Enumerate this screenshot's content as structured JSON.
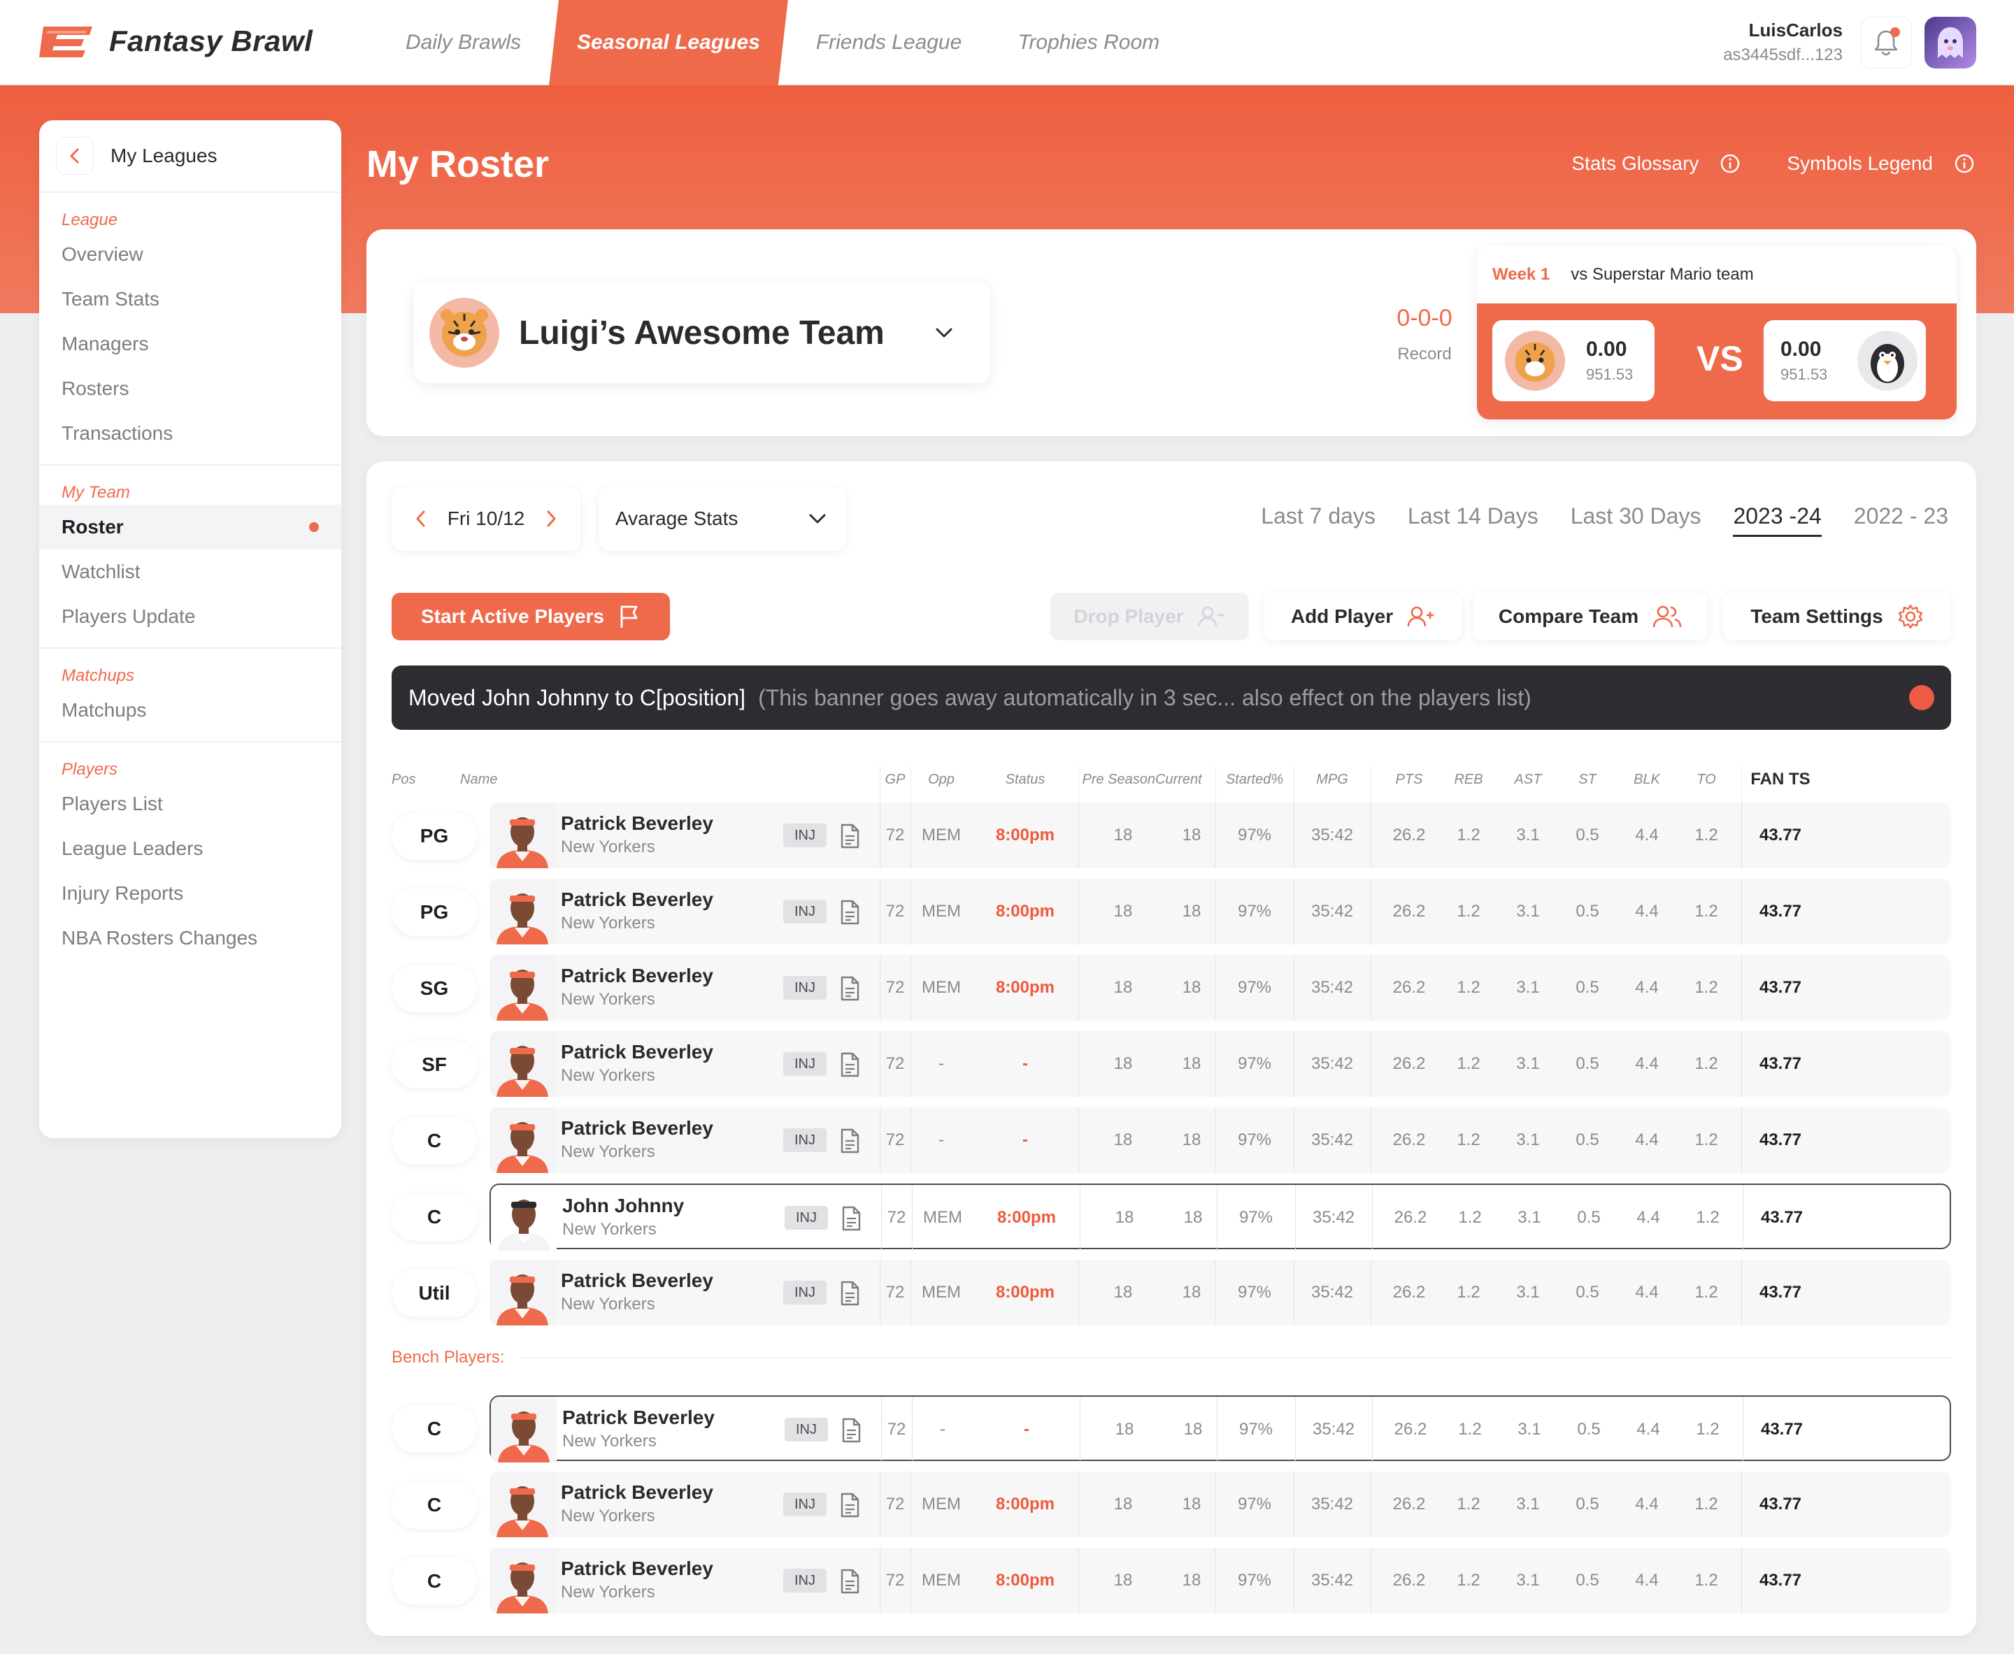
{
  "app": {
    "brand": "Fantasy Brawl",
    "nav": [
      {
        "label": "Daily Brawls",
        "active": false
      },
      {
        "label": "Seasonal Leagues",
        "active": true
      },
      {
        "label": "Friends League",
        "active": false
      },
      {
        "label": "Trophies Room",
        "active": false
      }
    ],
    "user": {
      "name": "LuisCarlos",
      "id": "as3445sdf...123"
    },
    "accent": "#ef6a4b"
  },
  "sidebar": {
    "title": "My Leagues",
    "sections": [
      {
        "label": "League",
        "items": [
          "Overview",
          "Team Stats",
          "Managers",
          "Rosters",
          "Transactions"
        ]
      },
      {
        "label": "My Team",
        "items": [
          "Roster",
          "Watchlist",
          "Players Update"
        ]
      },
      {
        "label": "Matchups",
        "items": [
          "Matchups"
        ]
      },
      {
        "label": "Players",
        "items": [
          "Players List",
          "League Leaders",
          "Injury Reports",
          "NBA Rosters Changes"
        ]
      }
    ],
    "active_item": "Roster"
  },
  "page": {
    "title": "My Roster",
    "links": [
      "Stats Glossary",
      "Symbols Legend"
    ]
  },
  "team": {
    "name": "Luigi’s Awesome Team",
    "record_value": "0-0-0",
    "record_label": "Record"
  },
  "matchup": {
    "week": "Week 1",
    "opponent": "vs Superstar Mario team",
    "home_score": "0.00",
    "home_proj": "951.53",
    "vs": "VS",
    "away_score": "0.00",
    "away_proj": "951.53"
  },
  "controls": {
    "date": "Fri 10/12",
    "stat_select": "Avarage Stats",
    "periods": [
      {
        "label": "Last 7 days",
        "active": false
      },
      {
        "label": "Last 14 Days",
        "active": false
      },
      {
        "label": "Last 30 Days",
        "active": false
      },
      {
        "label": "2023 -24",
        "active": true
      },
      {
        "label": "2022 - 23",
        "active": false
      }
    ],
    "buttons": {
      "start": "Start Active Players",
      "drop": "Drop Player",
      "add": "Add Player",
      "compare": "Compare Team",
      "settings": "Team Settings"
    }
  },
  "banner": {
    "main": "Moved John Johnny to C[position]",
    "sub": "(This banner goes away automatically in 3 sec... also effect on the players list)"
  },
  "table": {
    "headers": [
      "Pos",
      "Name",
      "GP",
      "Opp",
      "Status",
      "Pre Season",
      "Current",
      "Started%",
      "MPG",
      "PTS",
      "REB",
      "AST",
      "ST",
      "BLK",
      "TO",
      "FAN TS"
    ],
    "bench_label": "Bench Players:",
    "starters": [
      {
        "pos": "PG",
        "name": "Patrick Beverley",
        "team": "New Yorkers",
        "inj": "INJ",
        "gp": "72",
        "opp": "MEM",
        "status": "8:00pm",
        "pre": "18",
        "cur": "18",
        "started": "97%",
        "mpg": "35:42",
        "pts": "26.2",
        "reb": "1.2",
        "ast": "3.1",
        "st": "0.5",
        "blk": "4.4",
        "to": "1.2",
        "fan": "43.77",
        "selected": false,
        "photo": "orange"
      },
      {
        "pos": "PG",
        "name": "Patrick Beverley",
        "team": "New Yorkers",
        "inj": "INJ",
        "gp": "72",
        "opp": "MEM",
        "status": "8:00pm",
        "pre": "18",
        "cur": "18",
        "started": "97%",
        "mpg": "35:42",
        "pts": "26.2",
        "reb": "1.2",
        "ast": "3.1",
        "st": "0.5",
        "blk": "4.4",
        "to": "1.2",
        "fan": "43.77",
        "selected": false,
        "photo": "orange"
      },
      {
        "pos": "SG",
        "name": "Patrick Beverley",
        "team": "New Yorkers",
        "inj": "INJ",
        "gp": "72",
        "opp": "MEM",
        "status": "8:00pm",
        "pre": "18",
        "cur": "18",
        "started": "97%",
        "mpg": "35:42",
        "pts": "26.2",
        "reb": "1.2",
        "ast": "3.1",
        "st": "0.5",
        "blk": "4.4",
        "to": "1.2",
        "fan": "43.77",
        "selected": false,
        "photo": "orange"
      },
      {
        "pos": "SF",
        "name": "Patrick Beverley",
        "team": "New Yorkers",
        "inj": "INJ",
        "gp": "72",
        "opp": "-",
        "status": "-",
        "pre": "18",
        "cur": "18",
        "started": "97%",
        "mpg": "35:42",
        "pts": "26.2",
        "reb": "1.2",
        "ast": "3.1",
        "st": "0.5",
        "blk": "4.4",
        "to": "1.2",
        "fan": "43.77",
        "selected": false,
        "photo": "orange"
      },
      {
        "pos": "C",
        "name": "Patrick Beverley",
        "team": "New Yorkers",
        "inj": "INJ",
        "gp": "72",
        "opp": "-",
        "status": "-",
        "pre": "18",
        "cur": "18",
        "started": "97%",
        "mpg": "35:42",
        "pts": "26.2",
        "reb": "1.2",
        "ast": "3.1",
        "st": "0.5",
        "blk": "4.4",
        "to": "1.2",
        "fan": "43.77",
        "selected": false,
        "photo": "orange"
      },
      {
        "pos": "C",
        "name": "John Johnny",
        "team": "New Yorkers",
        "inj": "INJ",
        "gp": "72",
        "opp": "MEM",
        "status": "8:00pm",
        "pre": "18",
        "cur": "18",
        "started": "97%",
        "mpg": "35:42",
        "pts": "26.2",
        "reb": "1.2",
        "ast": "3.1",
        "st": "0.5",
        "blk": "4.4",
        "to": "1.2",
        "fan": "43.77",
        "selected": true,
        "photo": "white"
      },
      {
        "pos": "Util",
        "name": "Patrick Beverley",
        "team": "New Yorkers",
        "inj": "INJ",
        "gp": "72",
        "opp": "MEM",
        "status": "8:00pm",
        "pre": "18",
        "cur": "18",
        "started": "97%",
        "mpg": "35:42",
        "pts": "26.2",
        "reb": "1.2",
        "ast": "3.1",
        "st": "0.5",
        "blk": "4.4",
        "to": "1.2",
        "fan": "43.77",
        "selected": false,
        "photo": "orange"
      }
    ],
    "bench": [
      {
        "pos": "C",
        "name": "Patrick Beverley",
        "team": "New Yorkers",
        "inj": "INJ",
        "gp": "72",
        "opp": "-",
        "status": "-",
        "pre": "18",
        "cur": "18",
        "started": "97%",
        "mpg": "35:42",
        "pts": "26.2",
        "reb": "1.2",
        "ast": "3.1",
        "st": "0.5",
        "blk": "4.4",
        "to": "1.2",
        "fan": "43.77",
        "selected": true,
        "photo": "orange"
      },
      {
        "pos": "C",
        "name": "Patrick Beverley",
        "team": "New Yorkers",
        "inj": "INJ",
        "gp": "72",
        "opp": "MEM",
        "status": "8:00pm",
        "pre": "18",
        "cur": "18",
        "started": "97%",
        "mpg": "35:42",
        "pts": "26.2",
        "reb": "1.2",
        "ast": "3.1",
        "st": "0.5",
        "blk": "4.4",
        "to": "1.2",
        "fan": "43.77",
        "selected": false,
        "photo": "orange"
      },
      {
        "pos": "C",
        "name": "Patrick Beverley",
        "team": "New Yorkers",
        "inj": "INJ",
        "gp": "72",
        "opp": "MEM",
        "status": "8:00pm",
        "pre": "18",
        "cur": "18",
        "started": "97%",
        "mpg": "35:42",
        "pts": "26.2",
        "reb": "1.2",
        "ast": "3.1",
        "st": "0.5",
        "blk": "4.4",
        "to": "1.2",
        "fan": "43.77",
        "selected": false,
        "photo": "orange"
      }
    ]
  }
}
